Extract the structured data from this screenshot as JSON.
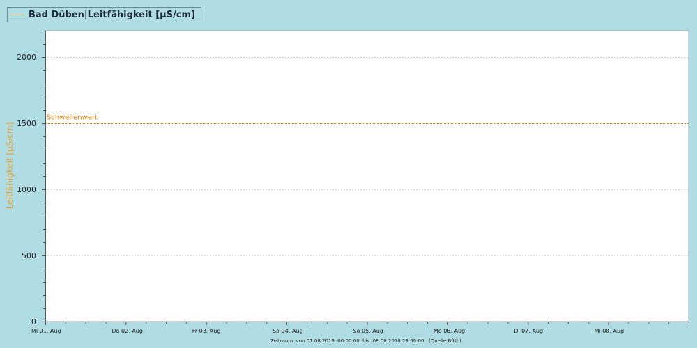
{
  "legend": {
    "series_label": "Bad Düben|Leitfähigkeit [µS/cm]",
    "series_color": "#e8a33a"
  },
  "chart_data": {
    "type": "line",
    "title": "",
    "xlabel": "",
    "ylabel": "Leitfähigkeit [µS/cm]",
    "ylim": [
      0,
      2200
    ],
    "y_ticks": [
      0,
      500,
      1000,
      1500,
      2000
    ],
    "x_ticks": [
      "Mi 01. Aug",
      "Do 02. Aug",
      "Fr 03. Aug",
      "Sa 04. Aug",
      "So 05. Aug",
      "Mo 06. Aug",
      "Di 07. Aug",
      "Mi 08. Aug"
    ],
    "x_range_days": [
      0,
      8
    ],
    "grid": true,
    "series": [
      {
        "name": "Bad Düben|Leitfähigkeit [µS/cm]",
        "values": []
      }
    ],
    "threshold": {
      "label": "Schwellenwert",
      "value": 1500,
      "color": "#e07b00"
    },
    "footer": {
      "zeitraum": "Zeitraum  von 01.08.2018  00:00:00  bis  08.08.2018 23:59:00",
      "quelle": "(Quelle:BfUL)"
    },
    "colors": {
      "background": "#b0dde4",
      "plot_background": "#ffffff",
      "axis_label": "#e8a33a",
      "threshold": "#e07b00",
      "grid": "#d8d8d8"
    }
  }
}
